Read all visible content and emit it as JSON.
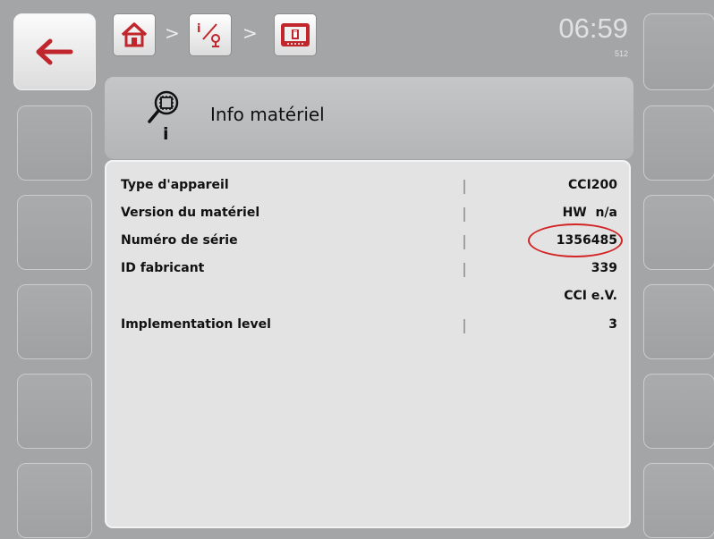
{
  "clock": {
    "time": "06:59",
    "sub": "512"
  },
  "breadcrumb": {
    "sep1": ">",
    "sep2": ">"
  },
  "header": {
    "title": "Info matériel"
  },
  "rows": [
    {
      "label": "Type d'appareil",
      "value": "CCI200",
      "has_separator": true
    },
    {
      "label": "Version du matériel",
      "value": "HW  n/a",
      "has_separator": true
    },
    {
      "label": "Numéro de série",
      "value": "1356485",
      "has_separator": true,
      "highlighted": true
    },
    {
      "label": "ID fabricant",
      "value": "339",
      "has_separator": true
    },
    {
      "label": "",
      "value": "CCI e.V.",
      "has_separator": false
    },
    {
      "label": "Implementation level",
      "value": "3",
      "has_separator": true
    }
  ],
  "colors": {
    "background": "#a3a5a7",
    "highlight": "#d32424",
    "icon_red": "#c0262b"
  }
}
